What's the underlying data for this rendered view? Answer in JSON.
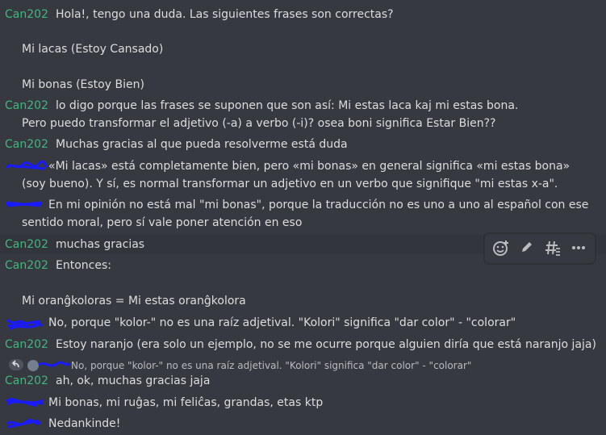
{
  "messages": [
    {
      "author": "Can202",
      "lines": [
        "Hola!, tengo una duda. Las siguientes frases son correctas?",
        "",
        "Mi lacas (Estoy Cansado)",
        "",
        "Mi bonas (Estoy Bien)"
      ]
    },
    {
      "author": "Can202",
      "lines": [
        "lo digo porque las frases se suponen que son así: Mi estas laca kaj mi estas bona.",
        "Pero puedo transformar el adjetivo (-a) a verbo (-i)? osea boni significa Estar Bien??"
      ]
    },
    {
      "author": "Can202",
      "lines": [
        "Muchas gracias al que pueda resolverme está duda"
      ]
    },
    {
      "author": "",
      "lines": [
        "«Mi lacas» está completamente bien, pero «mi bonas» en general significa «mi estas bona»",
        "(soy bueno). Y sí, es normal transformar un adjetivo en un verbo que signifique \"mi estas x-a\"."
      ]
    },
    {
      "author": "",
      "lines": [
        "En mi opinión no está mal \"mi bonas\", porque la traducción no es uno a uno al español con ese",
        "sentido moral, pero sí vale poner atención en eso"
      ]
    },
    {
      "author": "Can202",
      "lines": [
        "muchas gracias"
      ]
    },
    {
      "author": "Can202",
      "lines": [
        "Entonces:",
        "",
        "Mi oranĝkoloras = Mi estas oranĝkolora"
      ]
    },
    {
      "author": "",
      "lines": [
        "No, porque \"kolor-\" no es una raíz adjetival. \"Kolori\" significa \"dar color\" - \"colorar\""
      ]
    },
    {
      "author": "Can202",
      "lines": [
        "Estoy naranjo (era solo un ejemplo, no se me ocurre porque alguien diría que está naranjo jaja)"
      ]
    },
    {
      "author": "Can202",
      "lines": [
        "ah, ok, muchas gracias jaja"
      ]
    },
    {
      "author": "",
      "lines": [
        "Mi bonas, mi ruĝas, mi feliĉas, grandas, etas ktp"
      ]
    },
    {
      "author": "",
      "lines": [
        "Nedankinde!"
      ]
    }
  ],
  "reply_preview": "No, porque \"kolor-\" no es una raíz adjetival. \"Kolori\" significa \"dar color\" - \"colorar\"",
  "toolbar": {
    "add_reaction_icon": "emoji-add-icon",
    "edit_icon": "pencil-icon",
    "thread_icon": "thread-icon",
    "more_icon": "more-icon"
  },
  "colors": {
    "background": "#36393f",
    "author": "#43b581",
    "text": "#dcddde",
    "redaction": "#1a1aff"
  }
}
